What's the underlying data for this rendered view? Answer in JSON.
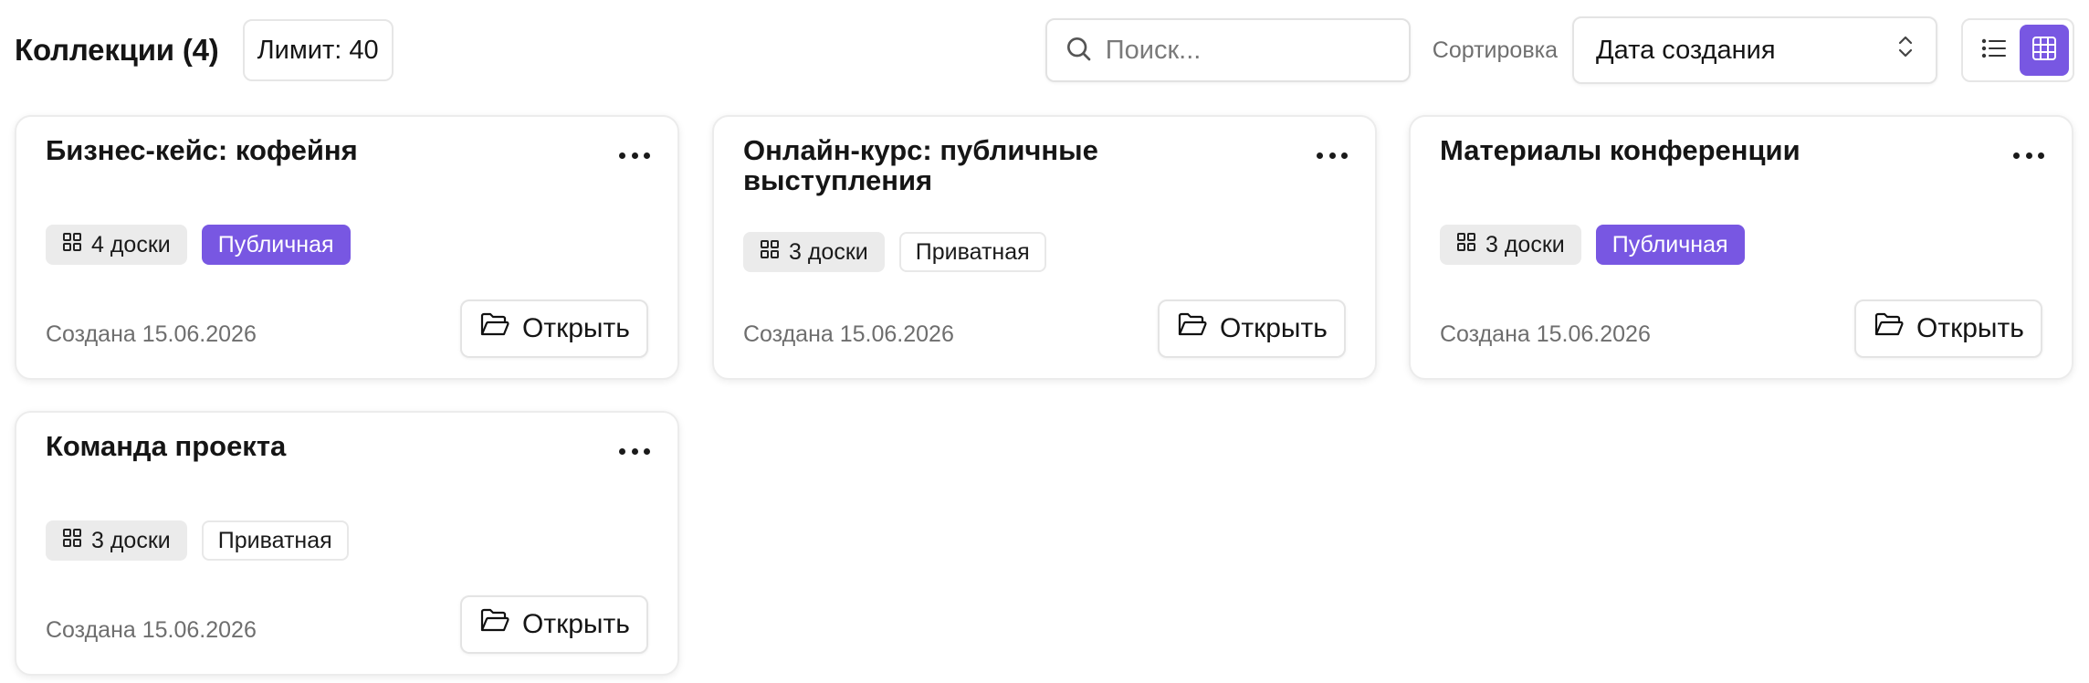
{
  "header": {
    "title": "Коллекции (4)",
    "limit": "Лимит: 40",
    "search_placeholder": "Поиск...",
    "sort_label": "Сортировка",
    "sort_value": "Дата создания"
  },
  "colors": {
    "accent": "#7857e2",
    "badge_gray": "#ebebeb",
    "muted_text": "#6e6e6e"
  },
  "icons": {
    "search": "search-icon",
    "sort": "chevron-updown-icon",
    "list_view": "list-icon",
    "grid_view": "grid-icon",
    "boards": "grid-small-icon",
    "menu": "more-horizontal-icon",
    "open": "folder-open-icon"
  },
  "collections": [
    {
      "title_lines": [
        "Бизнес-кейс: кофейня"
      ],
      "boards": "4 доски",
      "visibility": "Публичная",
      "is_public": true,
      "created": "Создана 15.06.2026",
      "open_label": "Открыть"
    },
    {
      "title_lines": [
        "Онлайн-курс: публичные",
        "выступления"
      ],
      "boards": "3 доски",
      "visibility": "Приватная",
      "is_public": false,
      "created": "Создана 15.06.2026",
      "open_label": "Открыть"
    },
    {
      "title_lines": [
        "Материалы конференции"
      ],
      "boards": "3 доски",
      "visibility": "Публичная",
      "is_public": true,
      "created": "Создана 15.06.2026",
      "open_label": "Открыть"
    },
    {
      "title_lines": [
        "Команда проекта"
      ],
      "boards": "3 доски",
      "visibility": "Приватная",
      "is_public": false,
      "created": "Создана 15.06.2026",
      "open_label": "Открыть"
    }
  ]
}
